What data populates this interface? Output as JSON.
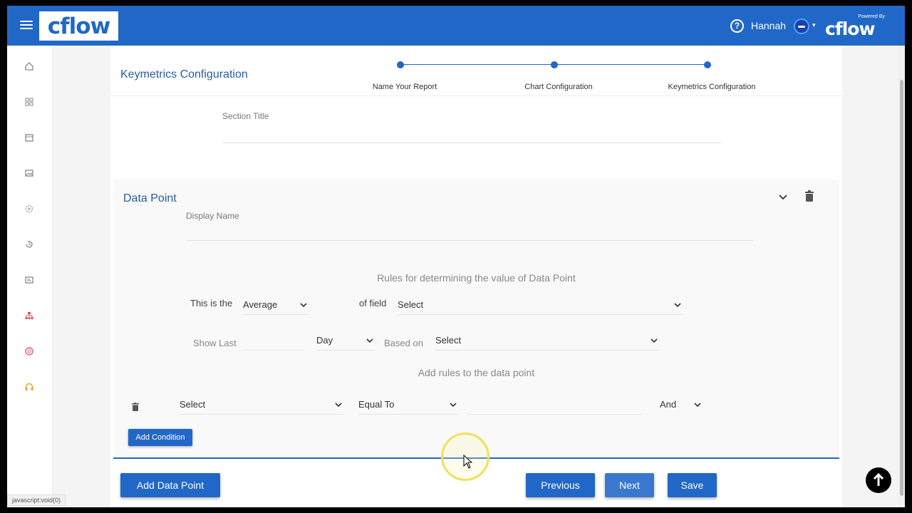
{
  "header": {
    "logo": "cflow",
    "help_icon": "help-circle-icon",
    "user_name": "Hannah",
    "powered_by": "Powered By",
    "powered_logo": "cflow",
    "brand_color": "#2167c7"
  },
  "sidebar": {
    "items": [
      {
        "icon": "home-icon"
      },
      {
        "icon": "grid-icon"
      },
      {
        "icon": "calendar-icon"
      },
      {
        "icon": "image-icon"
      },
      {
        "icon": "settings-icon"
      },
      {
        "icon": "history-icon"
      },
      {
        "icon": "id-card-icon"
      },
      {
        "icon": "sitemap-icon"
      },
      {
        "icon": "lifebuoy-icon"
      },
      {
        "icon": "headset-icon"
      }
    ]
  },
  "page": {
    "title": "Keymetrics Configuration",
    "steps": [
      {
        "label": "Name Your Report"
      },
      {
        "label": "Chart Configuration"
      },
      {
        "label": "Keymetrics Configuration"
      }
    ],
    "section_title_label": "Section Title",
    "section_title_value": ""
  },
  "data_point": {
    "title": "Data Point",
    "display_name_label": "Display Name",
    "display_name_value": "",
    "rules_heading": "Rules for determining the value of Data Point",
    "this_is_the_label": "This is the",
    "aggregate_value": "Average",
    "of_field_label": "of field",
    "field_value": "Select",
    "show_last_label": "Show Last",
    "show_last_value": "",
    "period_value": "Day",
    "based_on_label": "Based on",
    "based_on_value": "Select",
    "add_rules_heading": "Add rules to the data point",
    "condition": {
      "field_value": "Select",
      "operator_value": "Equal To",
      "compare_value": "",
      "join_value": "And"
    },
    "add_condition_label": "Add Condition"
  },
  "footer": {
    "add_data_point_label": "Add Data Point",
    "previous_label": "Previous",
    "next_label": "Next",
    "save_label": "Save"
  },
  "status_bar_text": "javascript:void(0)"
}
